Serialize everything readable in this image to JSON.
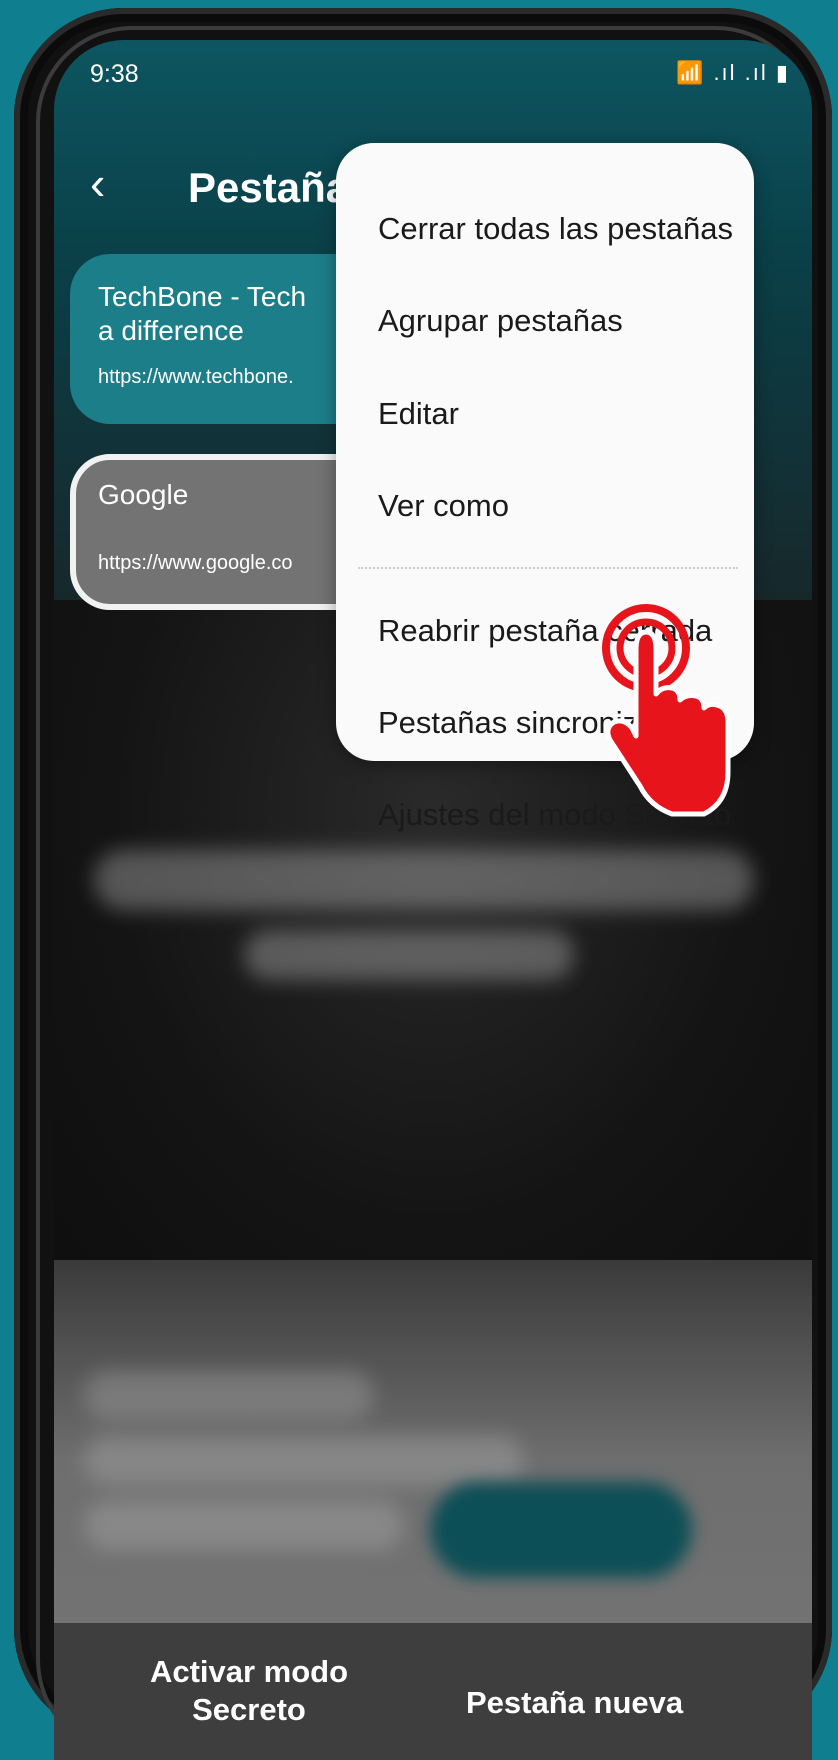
{
  "status_bar": {
    "time": "9:38",
    "icons_text": "📶 .ıl .ıl ▮"
  },
  "header": {
    "back_icon": "chevron-left-icon",
    "title": "Pestañas"
  },
  "tabs": [
    {
      "title": "TechBone - Tech",
      "title_line2": "a difference",
      "url": "https://www.techbone.",
      "accent": "#1c7e89"
    },
    {
      "title": "Google",
      "url": "https://www.google.co",
      "accent": "#737373"
    }
  ],
  "menu": {
    "items": [
      {
        "label": "Cerrar todas las pestañas"
      },
      {
        "label": "Agrupar pestañas"
      },
      {
        "label": "Editar"
      },
      {
        "label": "Ver como"
      },
      {
        "label": "Reabrir pestaña cerrada"
      },
      {
        "label": "Pestañas sincronizadas"
      },
      {
        "label": "Ajustes del modo Secreto"
      }
    ]
  },
  "bottom_bar": {
    "left_label": "Activar modo Secreto",
    "right_label": "Pestaña nueva"
  },
  "overlay": {
    "pointer_icon": "tap-hand-icon",
    "pointer_color": "#e8141c"
  }
}
